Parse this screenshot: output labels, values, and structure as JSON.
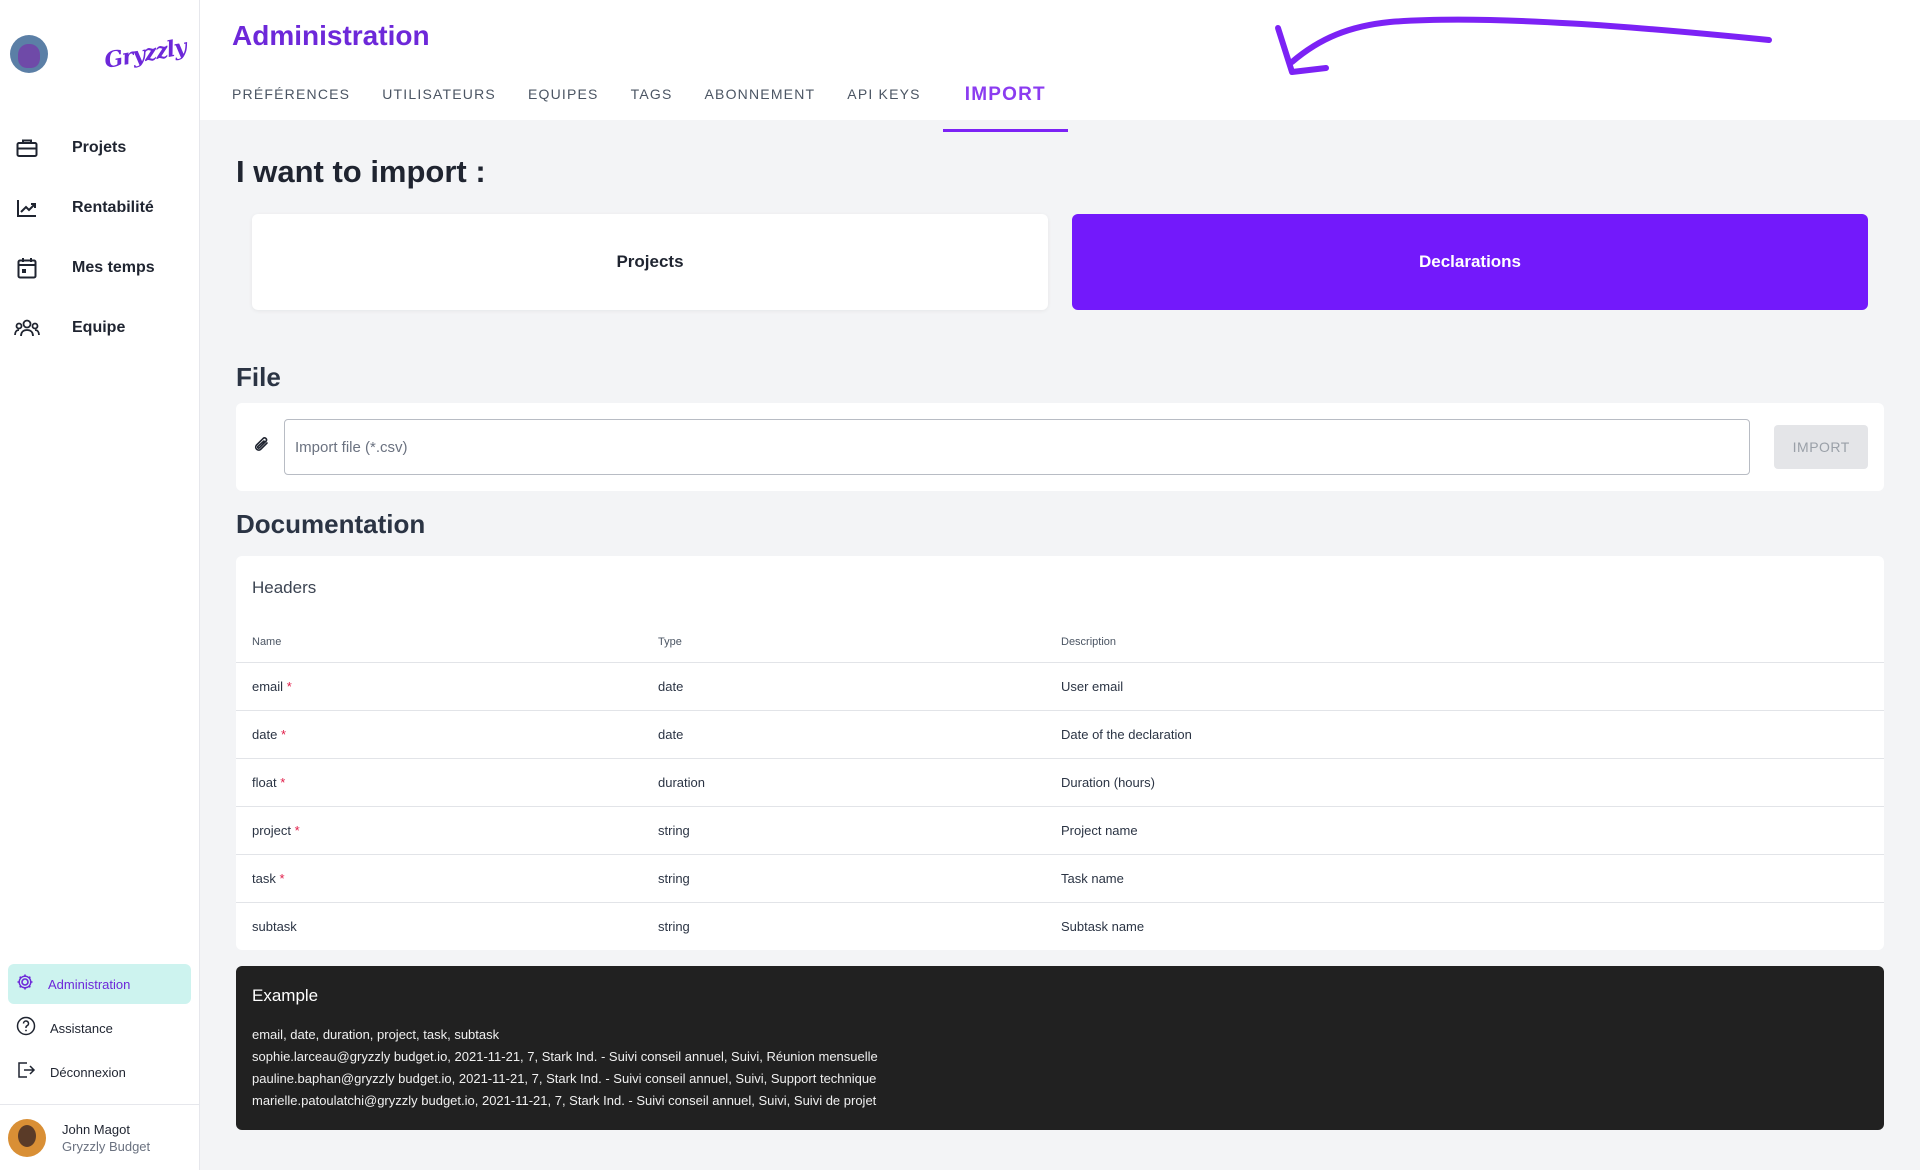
{
  "brand": {
    "logo_text": "Gryzzly"
  },
  "nav": [
    {
      "label": "Projets",
      "icon": "briefcase-icon"
    },
    {
      "label": "Rentabilité",
      "icon": "trending-up-icon"
    },
    {
      "label": "Mes temps",
      "icon": "calendar-icon"
    },
    {
      "label": "Equipe",
      "icon": "team-icon"
    }
  ],
  "sidebar_bottom": {
    "administration": "Administration",
    "assistance": "Assistance",
    "logout": "Déconnexion"
  },
  "user": {
    "name": "John Magot",
    "org": "Gryzzly Budget"
  },
  "header": {
    "title": "Administration",
    "tabs": [
      "PRÉFÉRENCES",
      "UTILISATEURS",
      "EQUIPES",
      "TAGS",
      "ABONNEMENT",
      "API KEYS",
      "IMPORT"
    ],
    "active_tab": "IMPORT"
  },
  "import": {
    "heading": "I want to import :",
    "choices": [
      "Projects",
      "Declarations"
    ],
    "selected": "Declarations"
  },
  "file": {
    "heading": "File",
    "placeholder": "Import file (*.csv)",
    "button": "IMPORT"
  },
  "documentation": {
    "heading": "Documentation",
    "card_title": "Headers",
    "columns": [
      "Name",
      "Type",
      "Description"
    ],
    "rows": [
      {
        "name": "email",
        "required": "*",
        "type": "date",
        "description": "User email"
      },
      {
        "name": "date",
        "required": "*",
        "type": "date",
        "description": "Date of the declaration"
      },
      {
        "name": "float",
        "required": "*",
        "type": "duration",
        "description": "Duration (hours)"
      },
      {
        "name": "project",
        "required": "*",
        "type": "string",
        "description": "Project name"
      },
      {
        "name": "task",
        "required": "*",
        "type": "string",
        "description": "Task name"
      },
      {
        "name": "subtask",
        "required": "",
        "type": "string",
        "description": "Subtask name"
      }
    ]
  },
  "example": {
    "title": "Example",
    "lines": [
      "email, date, duration, project, task, subtask",
      "sophie.larceau@gryzzly budget.io, 2021-11-21, 7, Stark Ind. - Suivi conseil annuel, Suivi, Réunion mensuelle",
      "pauline.baphan@gryzzly budget.io, 2021-11-21, 7, Stark Ind. - Suivi conseil annuel, Suivi, Support technique",
      "marielle.patoulatchi@gryzzly budget.io, 2021-11-21, 7, Stark Ind. - Suivi conseil annuel, Suivi, Suivi de projet"
    ]
  },
  "colors": {
    "accent": "#6d28d9",
    "primary_button": "#7319fb",
    "active_sidebar": "#cdf3ef"
  }
}
